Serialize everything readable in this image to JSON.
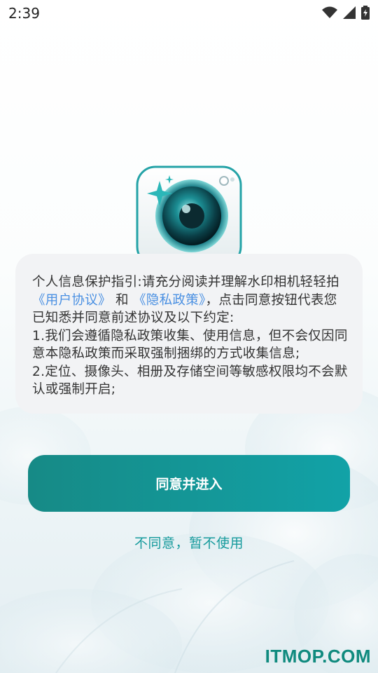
{
  "status_bar": {
    "time": "2:39",
    "icons": [
      "wifi-icon",
      "signal-icon",
      "battery-charging-icon"
    ]
  },
  "app_icon": {
    "name": "camera-app-icon"
  },
  "notice": {
    "segments": [
      "个人信息保护指引:请充分阅读并理解水印相机轻轻拍",
      "《用户协议》",
      " 和 ",
      "《隐私政策》",
      "，点击同意按钮代表您已知悉并同意前述协议及以下约定:",
      "1.我们会遵循隐私政策收集、使用信息，但不会仅因同意本隐私政策而采取强制捆绑的方式收集信息;",
      "2.定位、摄像头、相册及存储空间等敏感权限均不会默认或强制开启;"
    ]
  },
  "buttons": {
    "agree_label": "同意并进入",
    "decline_label": "不同意，暂不使用"
  },
  "watermark": "ITMOP.COM",
  "colors": {
    "accent": "#12a2a7",
    "link": "#4a90e2",
    "card_bg": "#f2f3f5"
  }
}
